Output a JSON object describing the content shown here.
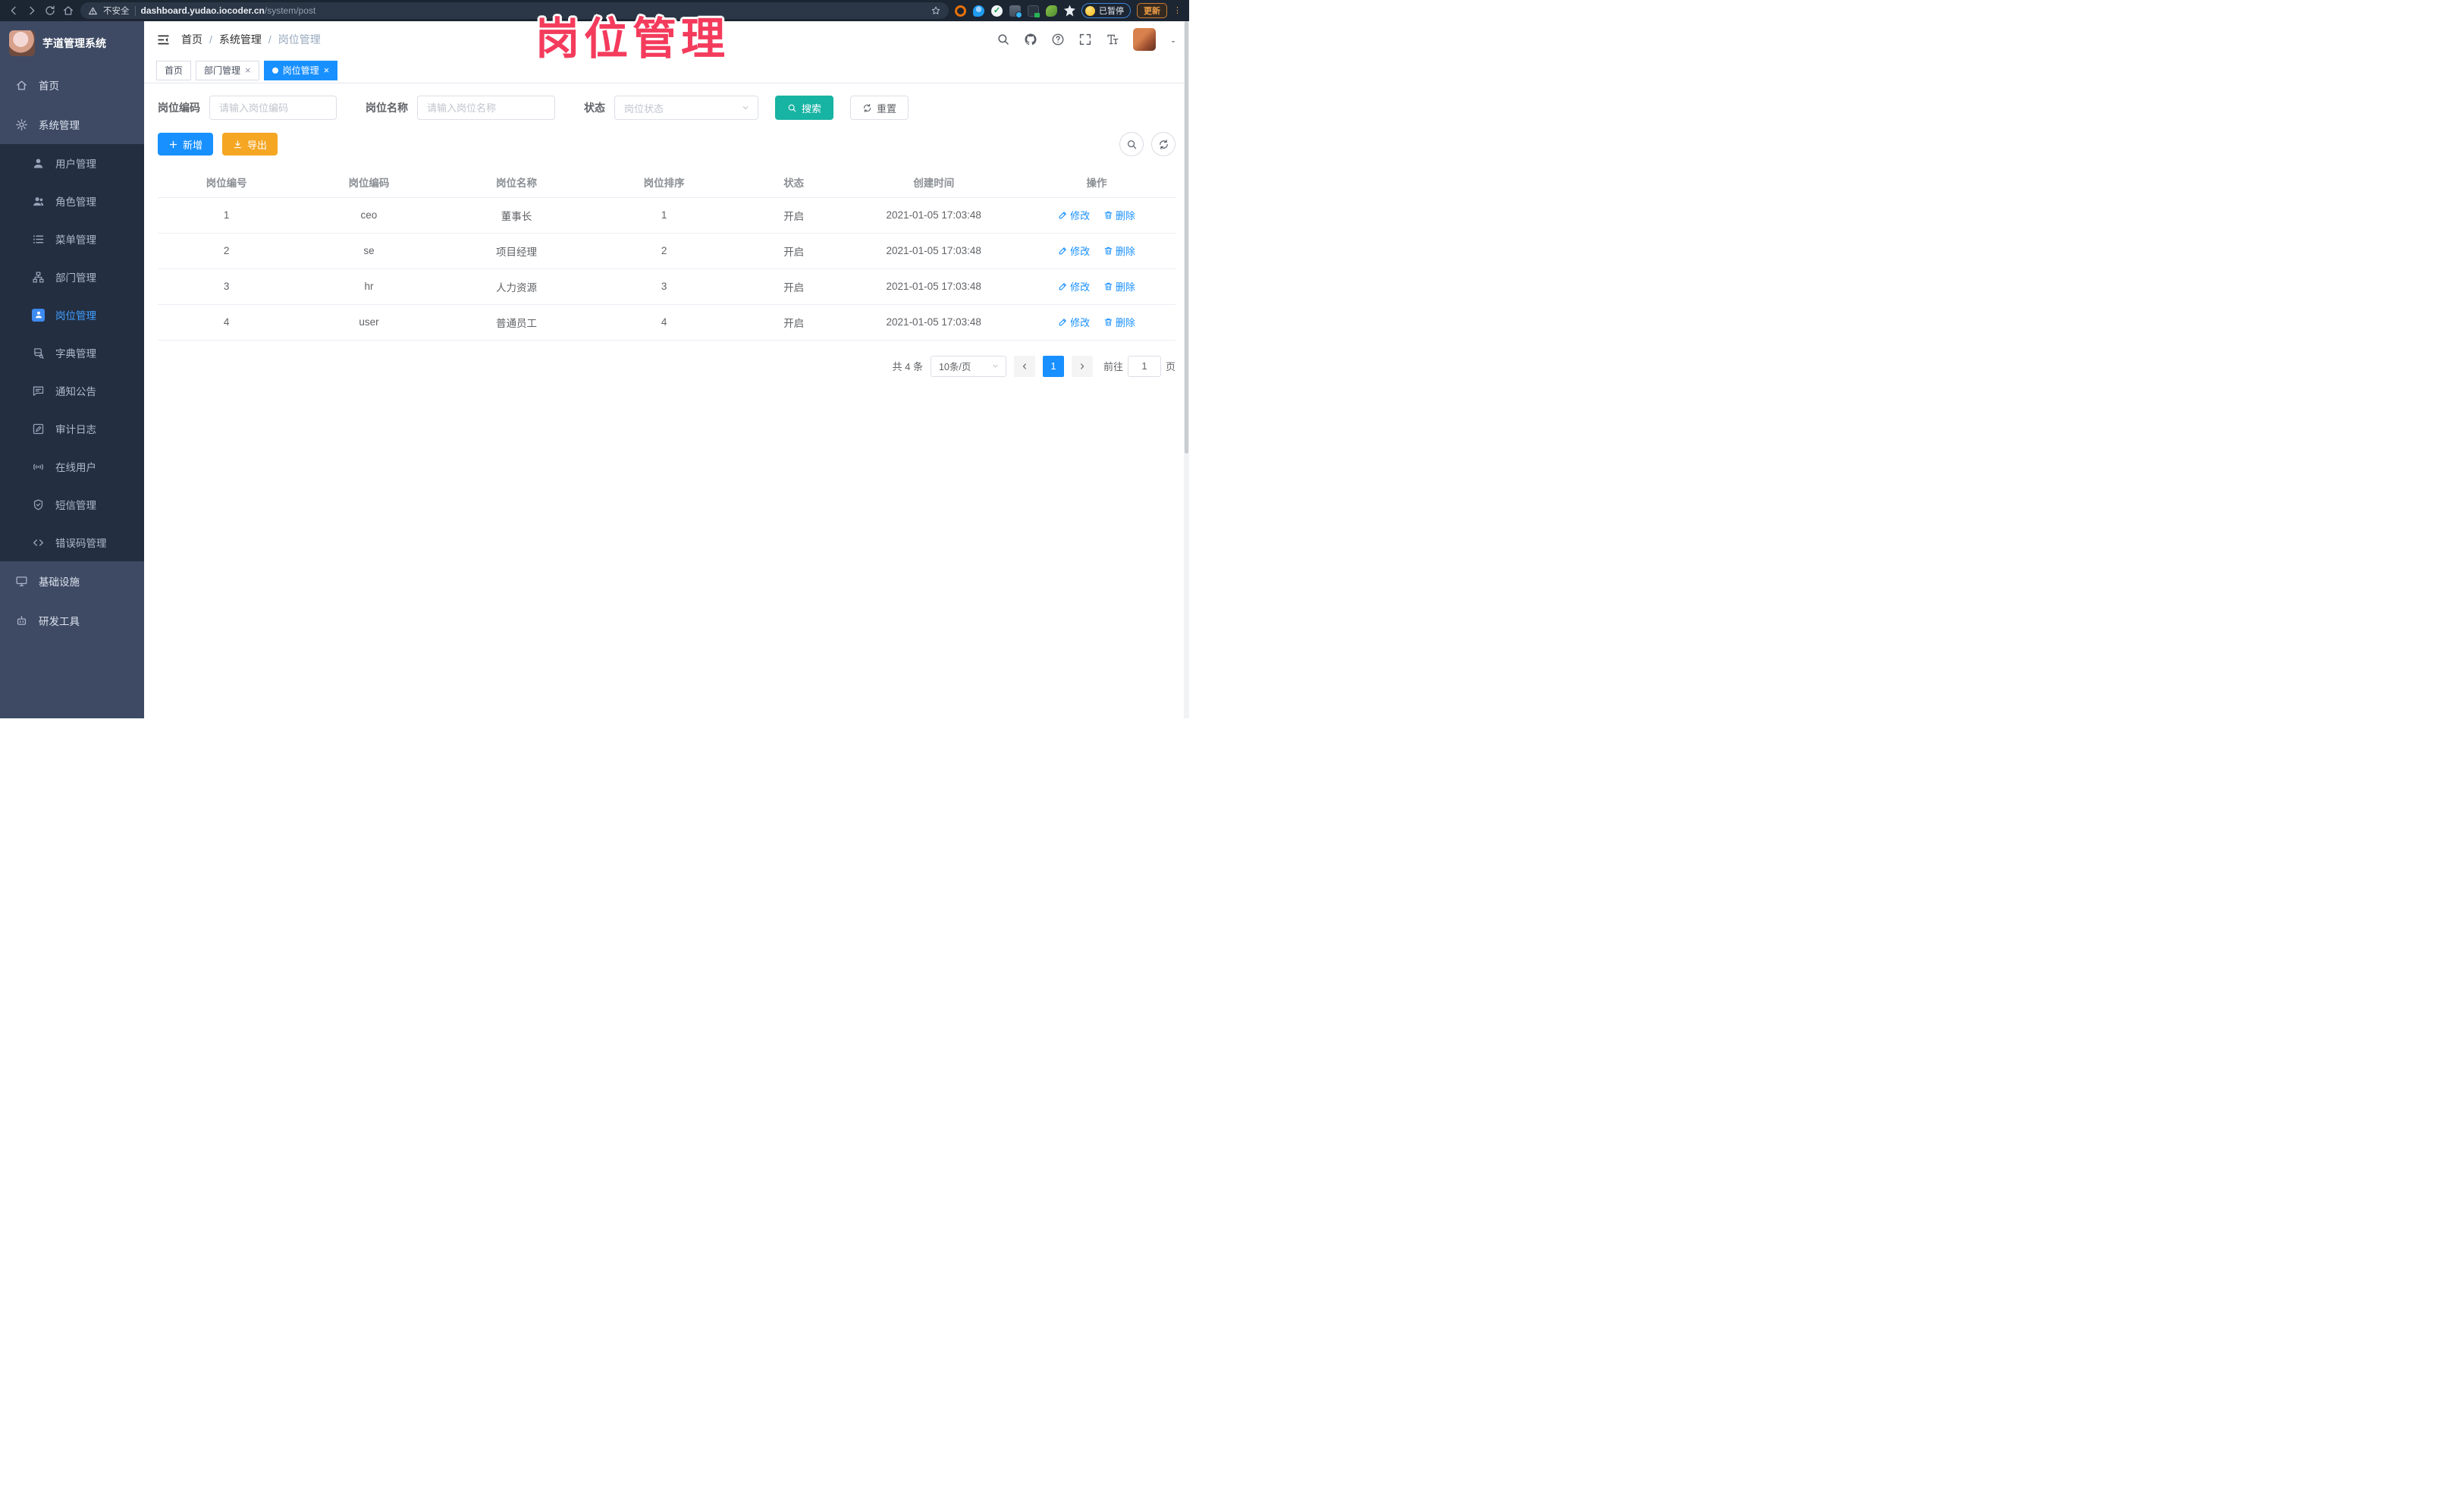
{
  "browser": {
    "security_label": "不安全",
    "url_host": "dashboard.yudao.iocoder.cn",
    "url_path": "/system/post",
    "paused_badge": "已暂停",
    "update_button": "更新"
  },
  "annotation": {
    "text": "岗位管理",
    "color": "#f43b5c"
  },
  "app": {
    "logo_title": "芋道管理系统",
    "breadcrumb": [
      "首页",
      "系统管理",
      "岗位管理"
    ],
    "tabs": [
      {
        "label": "首页",
        "closable": false,
        "active": false
      },
      {
        "label": "部门管理",
        "closable": true,
        "active": false
      },
      {
        "label": "岗位管理",
        "closable": true,
        "active": true
      }
    ]
  },
  "sidebar": {
    "items": [
      {
        "label": "首页",
        "icon": "home-icon"
      },
      {
        "label": "系统管理",
        "icon": "gear-icon",
        "expanded": true
      },
      {
        "label": "用户管理",
        "icon": "user-icon"
      },
      {
        "label": "角色管理",
        "icon": "users-icon"
      },
      {
        "label": "菜单管理",
        "icon": "menu-list-icon"
      },
      {
        "label": "部门管理",
        "icon": "org-tree-icon"
      },
      {
        "label": "岗位管理",
        "icon": "post-badge-icon",
        "active": true
      },
      {
        "label": "字典管理",
        "icon": "dictionary-icon"
      },
      {
        "label": "通知公告",
        "icon": "announcement-icon"
      },
      {
        "label": "审计日志",
        "icon": "audit-log-icon",
        "collapsed": true
      },
      {
        "label": "在线用户",
        "icon": "online-users-icon"
      },
      {
        "label": "短信管理",
        "icon": "sms-shield-icon",
        "collapsed": true
      },
      {
        "label": "错误码管理",
        "icon": "error-code-icon"
      },
      {
        "label": "基础设施",
        "icon": "infrastructure-icon",
        "collapsed": true
      },
      {
        "label": "研发工具",
        "icon": "dev-tools-icon",
        "collapsed": true
      }
    ]
  },
  "filters": {
    "post_code_label": "岗位编码",
    "post_code_placeholder": "请输入岗位编码",
    "post_name_label": "岗位名称",
    "post_name_placeholder": "请输入岗位名称",
    "status_label": "状态",
    "status_placeholder": "岗位状态",
    "search_button": "搜索",
    "reset_button": "重置"
  },
  "toolbar": {
    "add_button": "新增",
    "export_button": "导出"
  },
  "table": {
    "headers": [
      "岗位编号",
      "岗位编码",
      "岗位名称",
      "岗位排序",
      "状态",
      "创建时间",
      "操作"
    ],
    "rows": [
      {
        "id": "1",
        "code": "ceo",
        "name": "董事长",
        "sort": "1",
        "status": "开启",
        "created": "2021-01-05 17:03:48"
      },
      {
        "id": "2",
        "code": "se",
        "name": "项目经理",
        "sort": "2",
        "status": "开启",
        "created": "2021-01-05 17:03:48"
      },
      {
        "id": "3",
        "code": "hr",
        "name": "人力资源",
        "sort": "3",
        "status": "开启",
        "created": "2021-01-05 17:03:48"
      },
      {
        "id": "4",
        "code": "user",
        "name": "普通员工",
        "sort": "4",
        "status": "开启",
        "created": "2021-01-05 17:03:48"
      }
    ],
    "edit_label": "修改",
    "delete_label": "删除"
  },
  "pagination": {
    "total_text": "共 4 条",
    "page_size": "10条/页",
    "current_page": "1",
    "goto_label": "前往",
    "goto_value": "1",
    "page_suffix": "页"
  },
  "colors": {
    "accent_blue": "#1890ff",
    "search_teal": "#17b3a3",
    "export_orange": "#f5a623",
    "annotation_pink": "#f43b5c",
    "sidebar_bg": "#3e4a64",
    "submenu_bg": "#232e41"
  }
}
